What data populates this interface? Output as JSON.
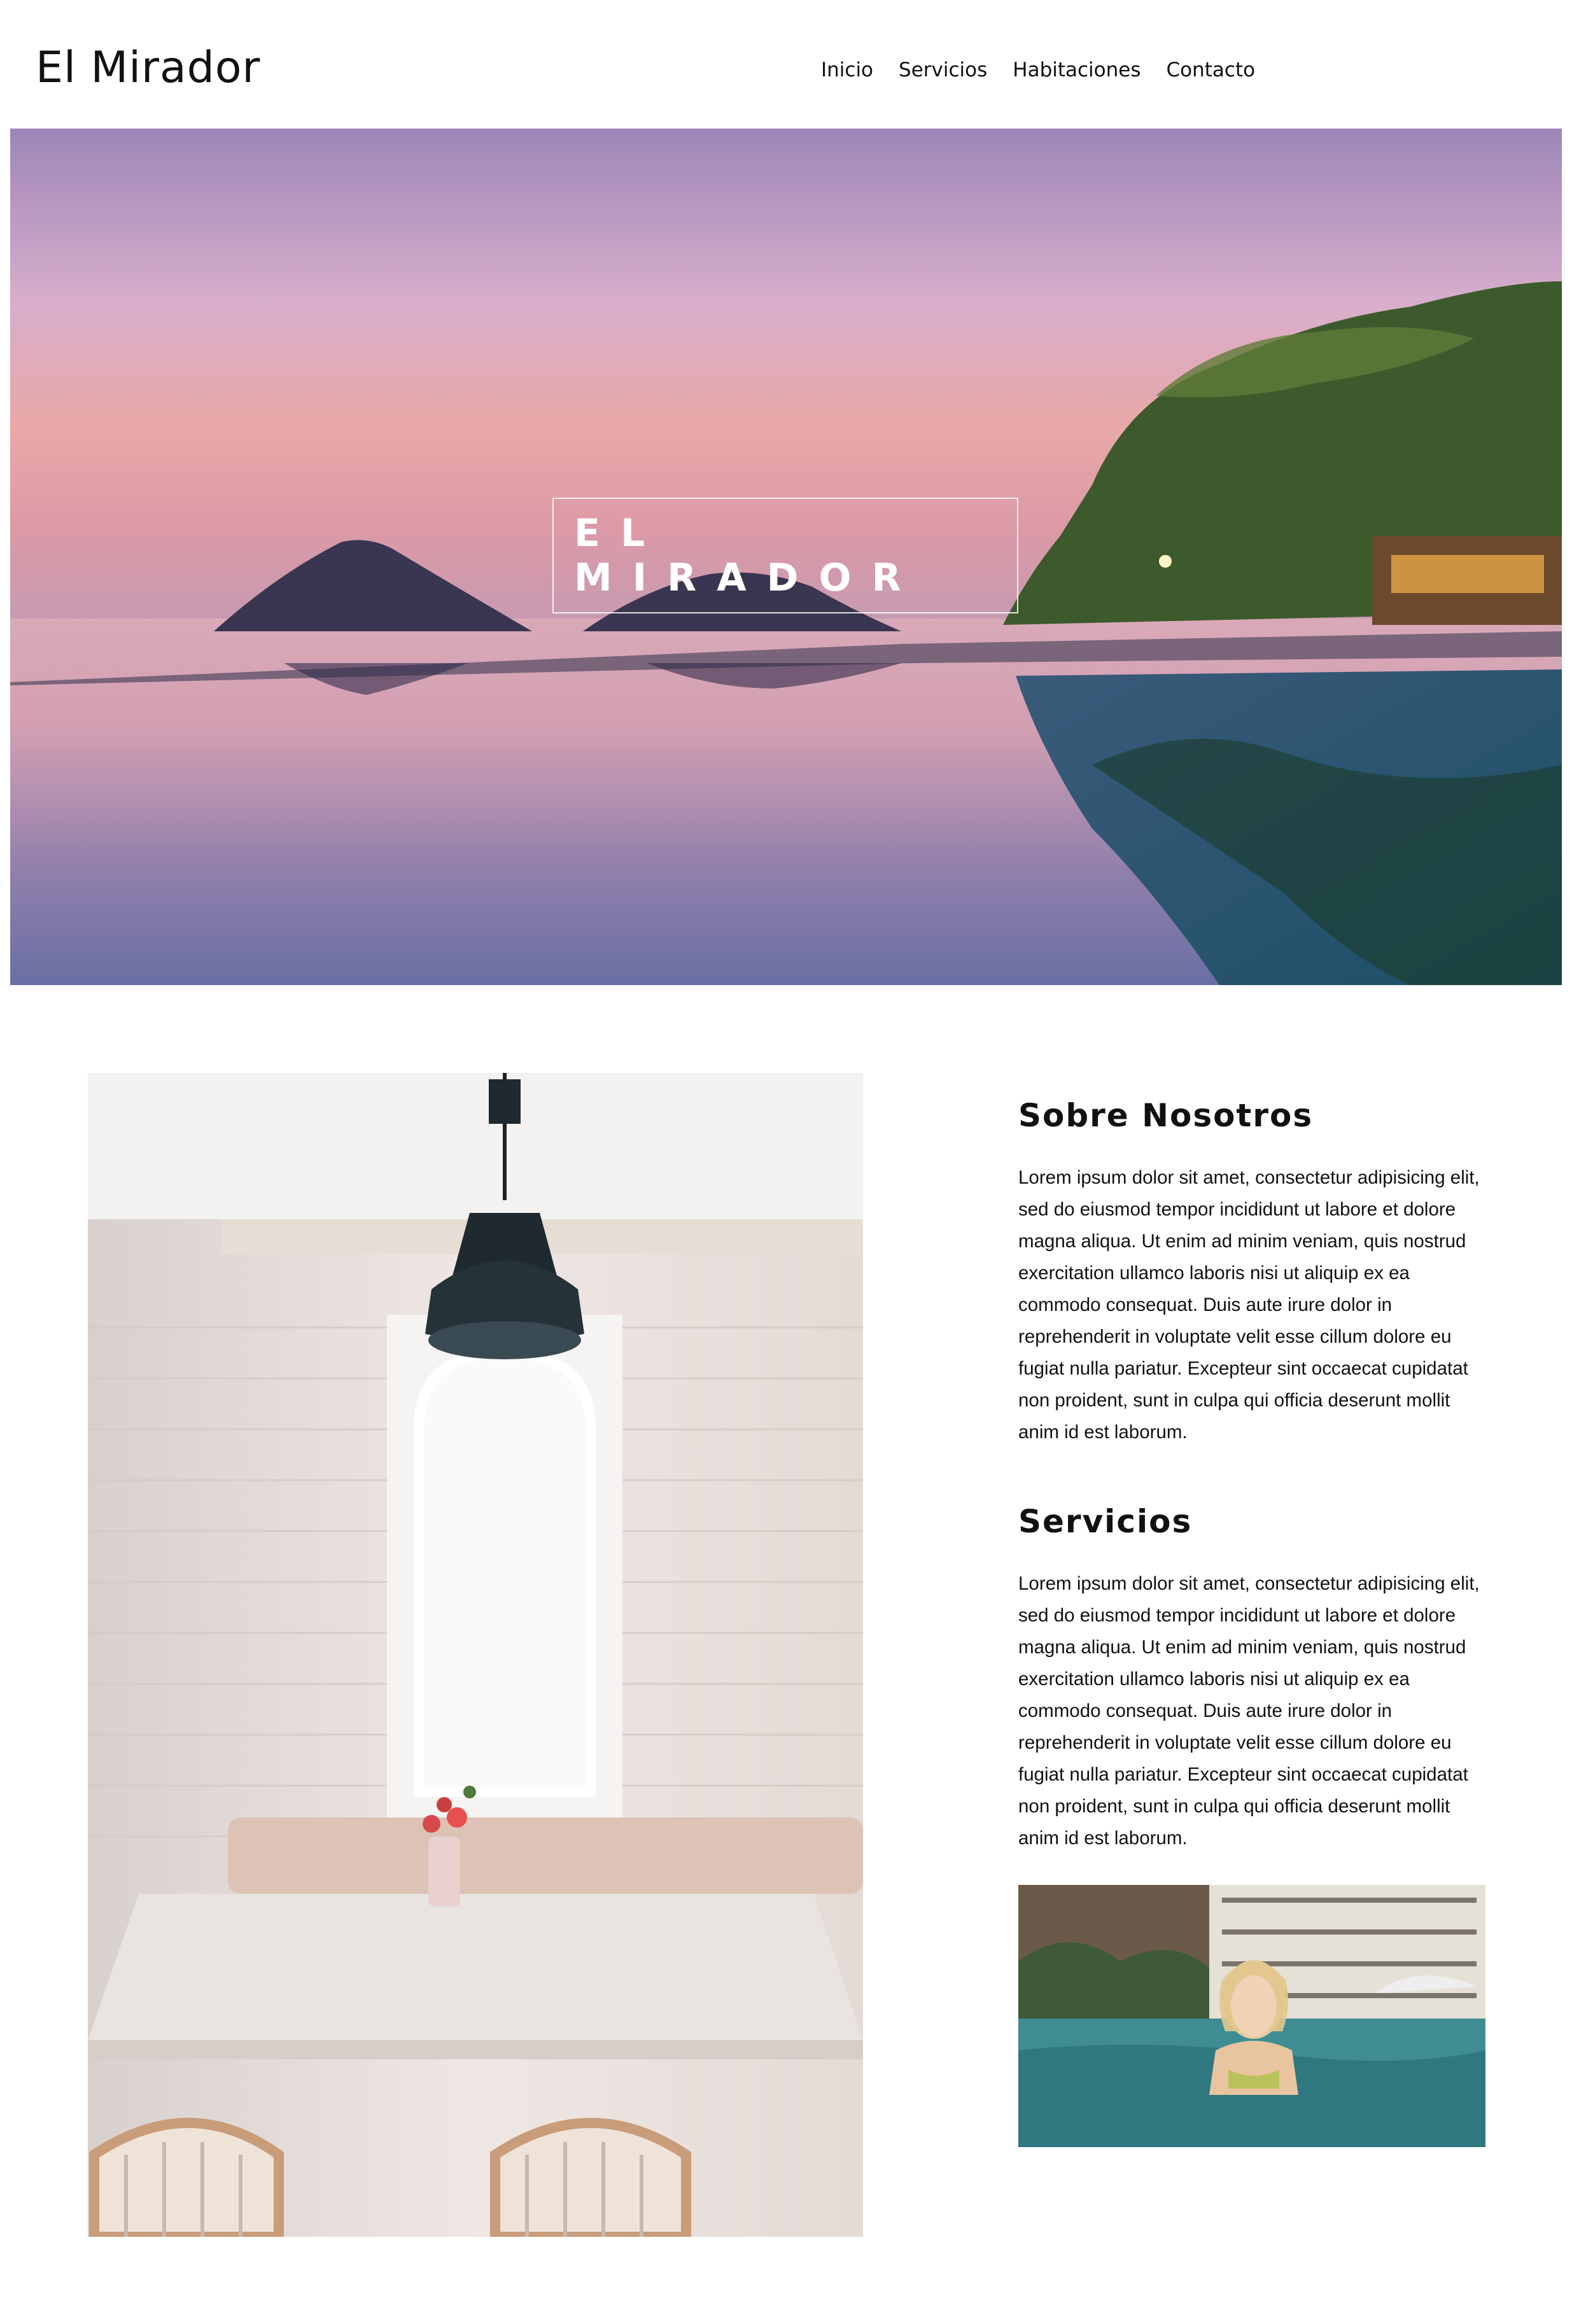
{
  "header": {
    "logo": "El Mirador",
    "nav": [
      "Inicio",
      "Servicios",
      "Habitaciones",
      "Contacto"
    ]
  },
  "hero": {
    "title": "EL MIRADOR",
    "image": "sunset-infinity-pool-photo"
  },
  "about": {
    "title": "Sobre Nosotros",
    "body": "Lorem ipsum dolor sit amet, consectetur adipisicing elit, sed do eiusmod tempor incididunt ut labore et dolore magna aliqua. Ut enim ad minim veniam, quis nostrud exercitation ullamco laboris nisi ut aliquip ex ea commodo consequat. Duis aute irure dolor in reprehenderit in voluptate velit esse cillum dolore eu fugiat nulla pariatur. Excepteur sint occaecat cupidatat non proident, sunt in culpa qui officia deserunt mollit anim id est laborum."
  },
  "services": {
    "title": "Servicios",
    "body": "Lorem ipsum dolor sit amet, consectetur adipisicing elit, sed do eiusmod tempor incididunt ut labore et dolore magna aliqua. Ut enim ad minim veniam, quis nostrud exercitation ullamco laboris nisi ut aliquip ex ea commodo consequat. Duis aute irure dolor in reprehenderit in voluptate velit esse cillum dolore eu fugiat nulla pariatur. Excepteur sint occaecat cupidatat non proident, sunt in culpa qui officia deserunt mollit anim id est laborum."
  },
  "images": {
    "room": "dining-room-photo",
    "pool": "hotel-pool-woman-photo"
  }
}
